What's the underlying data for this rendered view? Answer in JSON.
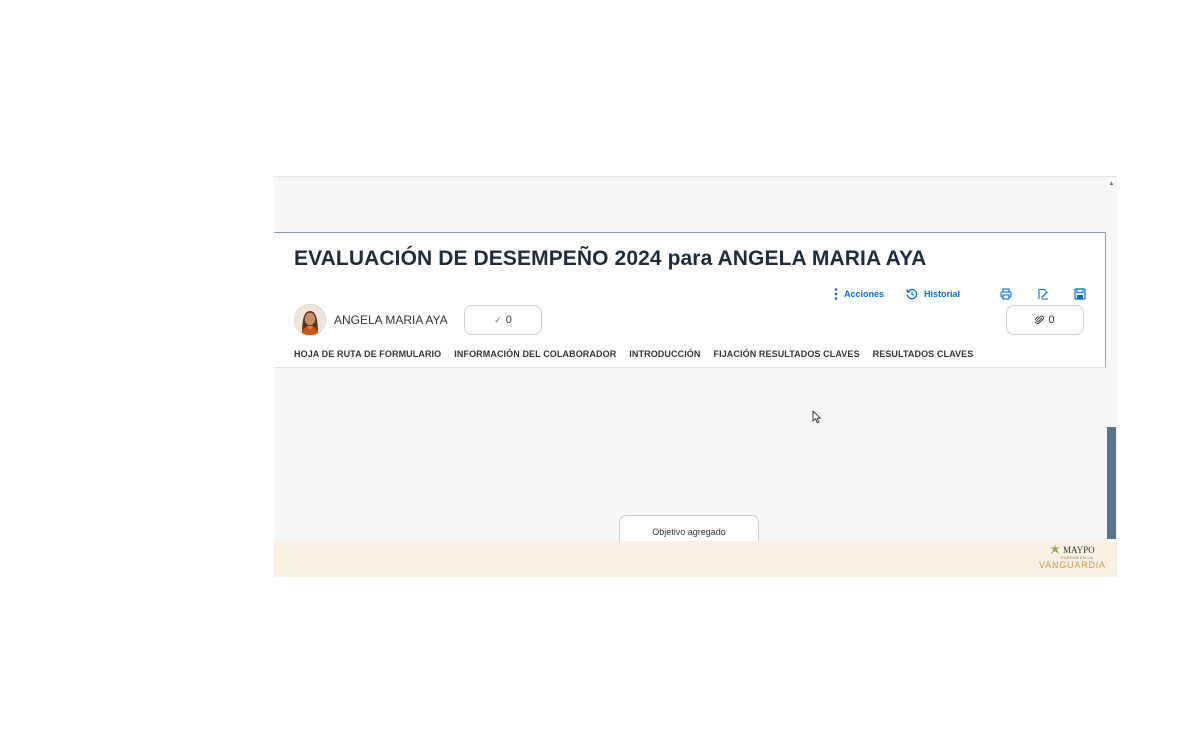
{
  "page": {
    "title": "EVALUACIÓN DE DESEMPEÑO 2024 para ANGELA MARIA AYA"
  },
  "toolbar": {
    "actions_label": "Acciones",
    "history_label": "Historial",
    "icons": [
      "print-icon",
      "sign-document-icon",
      "save-icon"
    ]
  },
  "employee": {
    "name": "ANGELA MARIA AYA"
  },
  "counters": {
    "completed_count": "0",
    "attachments_count": "0"
  },
  "tabs": [
    {
      "label": "HOJA DE RUTA DE FORMULARIO"
    },
    {
      "label": "INFORMACIÓN DEL COLABORADOR"
    },
    {
      "label": "INTRODUCCIÓN"
    },
    {
      "label": "FIJACIÓN RESULTADOS CLAVES"
    },
    {
      "label": "RESULTADOS CLAVES"
    }
  ],
  "toast": {
    "message": "Objetivo agregado"
  },
  "footer": {
    "logo": {
      "brand": "MAYPO",
      "tagline": "FUERZA EN LA",
      "wordmark": "VANGUARDIA"
    }
  },
  "colors": {
    "title": "#1d2d3e",
    "link": "#0a6ed1",
    "footer_bg": "#f8f0e3",
    "scroll_thumb": "#5b7190"
  }
}
